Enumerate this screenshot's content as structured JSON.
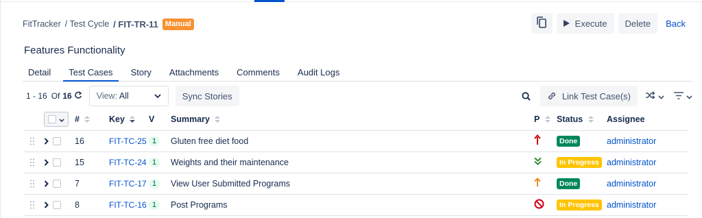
{
  "breadcrumb": {
    "project": "FitTracker",
    "section": "/ Test Cycle",
    "key": "/ FIT-TR-11",
    "badge": "Manual"
  },
  "actions": {
    "execute": "Execute",
    "delete": "Delete",
    "back": "Back"
  },
  "page": {
    "title": "Features Functionality"
  },
  "tabs": [
    {
      "label": "Detail",
      "active": false
    },
    {
      "label": "Test Cases",
      "active": true
    },
    {
      "label": "Story",
      "active": false
    },
    {
      "label": "Attachments",
      "active": false
    },
    {
      "label": "Comments",
      "active": false
    },
    {
      "label": "Audit Logs",
      "active": false
    }
  ],
  "toolbar": {
    "range_start": "1 - 16",
    "of_label": "Of",
    "total": "16",
    "view_prefix": "View:",
    "view_value": "All",
    "sync_label": "Sync Stories",
    "link_label": "Link Test Case(s)"
  },
  "table": {
    "headers": {
      "num": "#",
      "key": "Key",
      "v": "V",
      "summary": "Summary",
      "p": "P",
      "status": "Status",
      "assignee": "Assignee"
    },
    "rows": [
      {
        "num": "16",
        "key": "FIT-TC-25",
        "v": "1",
        "summary": "Gluten free diet food",
        "priority": "highest-icon",
        "status": "Done",
        "assignee": "administrator"
      },
      {
        "num": "15",
        "key": "FIT-TC-24",
        "v": "1",
        "summary": "Weights and their maintenance",
        "priority": "lowest-icon",
        "status": "In Progress",
        "assignee": "administrator"
      },
      {
        "num": "7",
        "key": "FIT-TC-17",
        "v": "1",
        "summary": "View User Submitted Programs",
        "priority": "medium-icon",
        "status": "Done",
        "assignee": "administrator"
      },
      {
        "num": "8",
        "key": "FIT-TC-16",
        "v": "1",
        "summary": "Post Programs",
        "priority": "blocker-icon",
        "status": "In Progress",
        "assignee": "administrator"
      }
    ]
  },
  "colors": {
    "accent": "#0052cc",
    "done": "#00875a",
    "in_progress": "#ffc400",
    "manual": "#f79232",
    "highest": "#cc0000",
    "lowest": "#2f8f3a",
    "medium": "#f08a24",
    "blocker": "#d0021b"
  }
}
